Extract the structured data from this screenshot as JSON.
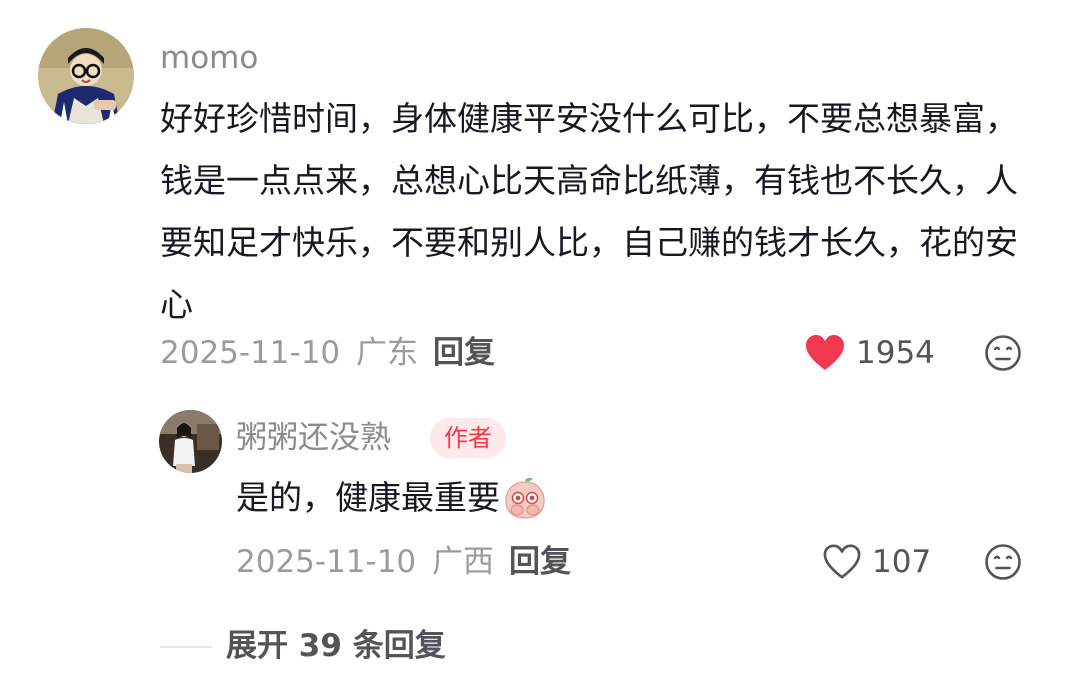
{
  "comment": {
    "username": "momo",
    "text": "好好珍惜时间，身体健康平安没什么可比，不要总想暴富，钱是一点点来，总想心比天高命比纸薄，有钱也不长久，人要知足才快乐，不要和别人比，自己赚的钱才长久，花的安心",
    "date": "2025-11-10",
    "location": "广东",
    "reply_label": "回复",
    "like_count": "1954",
    "liked": true,
    "icons": {
      "like": "heart-filled-icon",
      "dislike": "meh-face-icon"
    },
    "colors": {
      "like": "#f2384f"
    }
  },
  "reply": {
    "username": "粥粥还没熟",
    "author_tag": "作者",
    "text": "是的，健康最重要",
    "emoji": "peach-hands-over-mouth-emoji",
    "date": "2025-11-10",
    "location": "广西",
    "reply_label": "回复",
    "like_count": "107",
    "liked": false,
    "icons": {
      "like": "heart-outline-icon",
      "dislike": "meh-face-icon"
    }
  },
  "expand": {
    "label": "展开 39 条回复"
  }
}
